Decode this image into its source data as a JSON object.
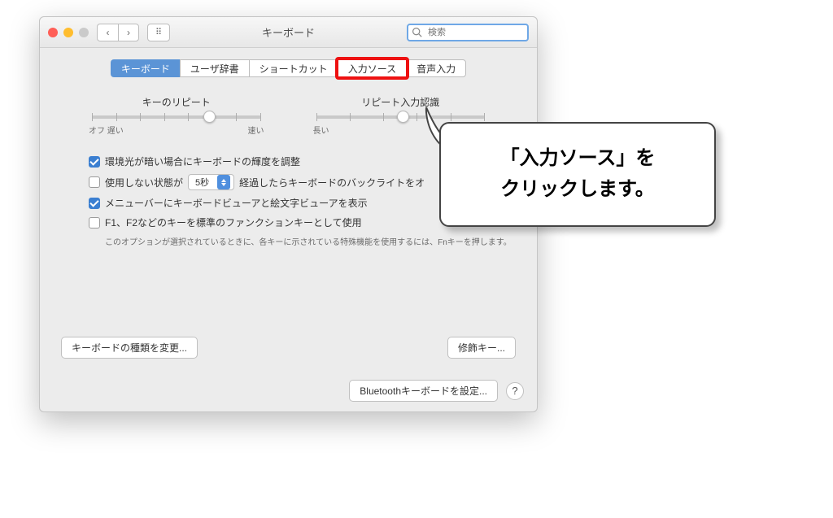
{
  "titlebar": {
    "title": "キーボード"
  },
  "search": {
    "placeholder": "検索"
  },
  "tabs": {
    "keyboard": "キーボード",
    "user_dict": "ユーザ辞書",
    "shortcut": "ショートカット",
    "input_source": "入力ソース",
    "dictation": "音声入力"
  },
  "sliders": {
    "key_repeat": {
      "title": "キーのリピート",
      "left": "オフ 遅い",
      "right": "速い"
    },
    "delay": {
      "title": "リピート入力認識",
      "left": "長い",
      "right": ""
    }
  },
  "checks": {
    "backlight_adjust": "環境光が暗い場合にキーボードの輝度を調整",
    "turn_off_prefix": "使用しない状態が",
    "turn_off_select": "5秒",
    "turn_off_suffix": "経過したらキーボードのバックライトをオ",
    "show_viewers": "メニューバーにキーボードビューアと絵文字ビューアを表示",
    "fn_keys": "F1、F2などのキーを標準のファンクションキーとして使用",
    "fn_note": "このオプションが選択されているときに、各キーに示されている特殊機能を使用するには、Fnキーを押します。"
  },
  "buttons": {
    "change_type": "キーボードの種類を変更...",
    "modifier": "修飾キー...",
    "bluetooth": "Bluetoothキーボードを設定...",
    "help": "?"
  },
  "callout": {
    "line1": "「入力ソース」を",
    "line2": "クリックします。"
  }
}
